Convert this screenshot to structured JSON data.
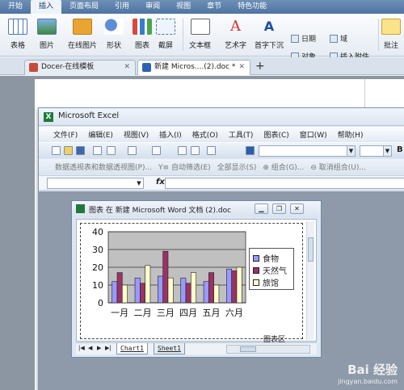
{
  "wps": {
    "menus": [
      "开始",
      "插入",
      "页面布局",
      "引用",
      "审阅",
      "视图",
      "章节",
      "特色功能"
    ],
    "active_menu": "插入",
    "ribbon": {
      "table": "表格",
      "picture": "图片",
      "online_picture": "在线图片",
      "shape": "形状",
      "chart": "图表",
      "screenshot": "截屏",
      "textbox": "文本框",
      "wordart": "艺术字",
      "dropcap": "首字下沉",
      "date": "日期",
      "object": "对象",
      "field": "域",
      "attachment": "插入附件",
      "comment": "批注"
    },
    "tabs": [
      {
        "title": "Docer-在线模板",
        "color": "#c64b3c"
      },
      {
        "title": "新建 Micros....(2).doc *",
        "color": "#2f62b6"
      }
    ],
    "new_tab": "+"
  },
  "excel": {
    "title": "Microsoft Excel",
    "menu": [
      "文件(F)",
      "编辑(E)",
      "视图(V)",
      "插入(I)",
      "格式(O)",
      "工具(T)",
      "图表(C)",
      "窗口(W)",
      "帮助(H)"
    ],
    "toolbar2": [
      "数据透视表和数据透视图(P)...",
      "Y≡ 自动筛选(E)",
      "全部显示(S)",
      "⊕ 组合(G)...",
      "⊖ 取消组合(U)..."
    ],
    "fx": "fx",
    "bold": "B"
  },
  "chart_window": {
    "title": "图表 在 新建 Microsoft Word 文档 (2).doc",
    "sheets": [
      "Chart1",
      "Sheet1"
    ],
    "area_label": "图表区",
    "nav_arrows": [
      "|◀",
      "◀",
      "▶",
      "▶|"
    ]
  },
  "chart_data": {
    "type": "bar",
    "categories": [
      "一月",
      "二月",
      "三月",
      "四月",
      "五月",
      "六月"
    ],
    "series": [
      {
        "name": "食物",
        "color": "#9999ff",
        "values": [
          12,
          14,
          15,
          14,
          12,
          19
        ]
      },
      {
        "name": "天然气",
        "color": "#993366",
        "values": [
          17,
          11,
          29,
          11,
          17,
          18
        ]
      },
      {
        "name": "旅馆",
        "color": "#ffffcc",
        "values": [
          10,
          21,
          14,
          17,
          10,
          20
        ]
      }
    ],
    "ylim": [
      0,
      40
    ],
    "yticks": [
      0,
      10,
      20,
      30,
      40
    ],
    "plot_background": "#c0c0c0",
    "grid": true,
    "legend": "right"
  },
  "watermark": {
    "brand": "Bai 经验",
    "url": "jingyan.baidu.com"
  }
}
